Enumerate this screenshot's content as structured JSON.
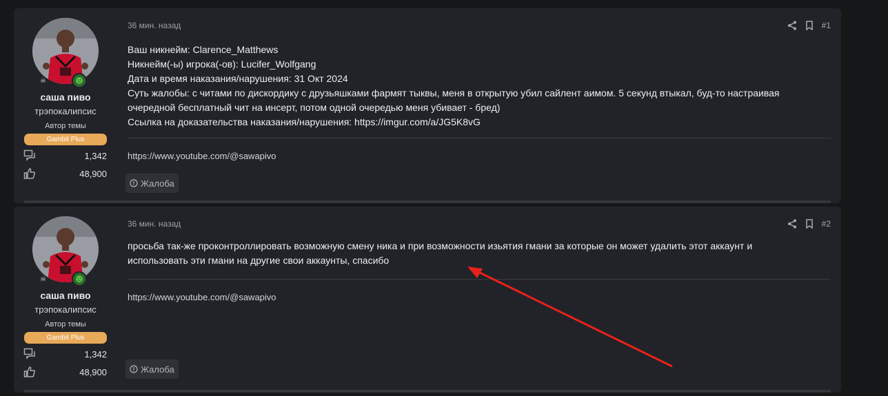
{
  "posts": [
    {
      "user": {
        "name": "саша пиво",
        "title": "трэпокалипсис",
        "author_label": "Автор темы",
        "badge": "Gambit Plus",
        "messages_count": "1,342",
        "reactions_count": "48,900"
      },
      "time": "36 мин. назад",
      "number": "#1",
      "lines": [
        "Ваш никнейм: Clarence_Matthews",
        "Никнейм(-ы) игрока(-ов): Lucifer_Wolfgang",
        "Дата и время наказания/нарушения: 31 Окт 2024",
        "Суть жалобы: с читами по дискордику с друзьяшками фармят тыквы, меня в открытую убил сайлент аимом. 5 секунд втыкал, буд-то настраивая",
        "очередной бесплатный чит на инсерт, потом одной очередью меня убивает - бред)",
        "Ссылка на доказательства наказания/нарушения: https://imgur.com/a/JG5K8vG"
      ],
      "signature": "https://www.youtube.com/@sawapivo",
      "report_label": "Жалоба"
    },
    {
      "user": {
        "name": "саша пиво",
        "title": "трэпокалипсис",
        "author_label": "Автор темы",
        "badge": "Gambit Plus",
        "messages_count": "1,342",
        "reactions_count": "48,900"
      },
      "time": "36 мин. назад",
      "number": "#2",
      "lines": [
        "просьба так-же проконтроллировать возможную смену ника и при возможности изьятия гмани за которые он может удалить этот аккаунт и",
        "использовать эти гмани на другие свои аккаунты, спасибо"
      ],
      "signature": "https://www.youtube.com/@sawapivo",
      "report_label": "Жалоба"
    }
  ],
  "colors": {
    "background": "#161719",
    "post_background": "#212328",
    "badge": "#e8a959",
    "annotation_arrow": "#e8211b"
  },
  "icons": [
    "share-icon",
    "bookmark-icon",
    "messages-icon",
    "thumbs-up-icon",
    "report-icon",
    "skull-icon",
    "status-icon"
  ]
}
